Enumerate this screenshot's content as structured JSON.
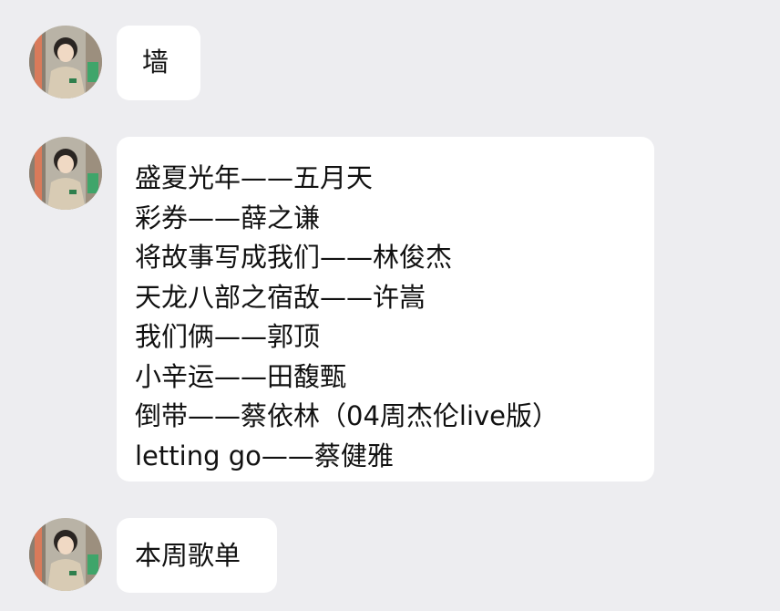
{
  "messages": [
    {
      "sender": "contact",
      "lines": [
        "墙"
      ]
    },
    {
      "sender": "contact",
      "lines": [
        "盛夏光年——五月天",
        "彩券——薛之谦",
        "将故事写成我们——林俊杰",
        "天龙八部之宿敌——许嵩",
        "我们俩——郭顶",
        "小辛运——田馥甄",
        "倒带——蔡依林（04周杰伦live版）",
        "letting go——蔡健雅"
      ]
    },
    {
      "sender": "contact",
      "lines": [
        "本周歌单"
      ]
    }
  ],
  "colors": {
    "background": "#ededf0",
    "bubble": "#ffffff",
    "text": "#111111"
  },
  "icons": {
    "avatar": "user-avatar-illustration"
  }
}
